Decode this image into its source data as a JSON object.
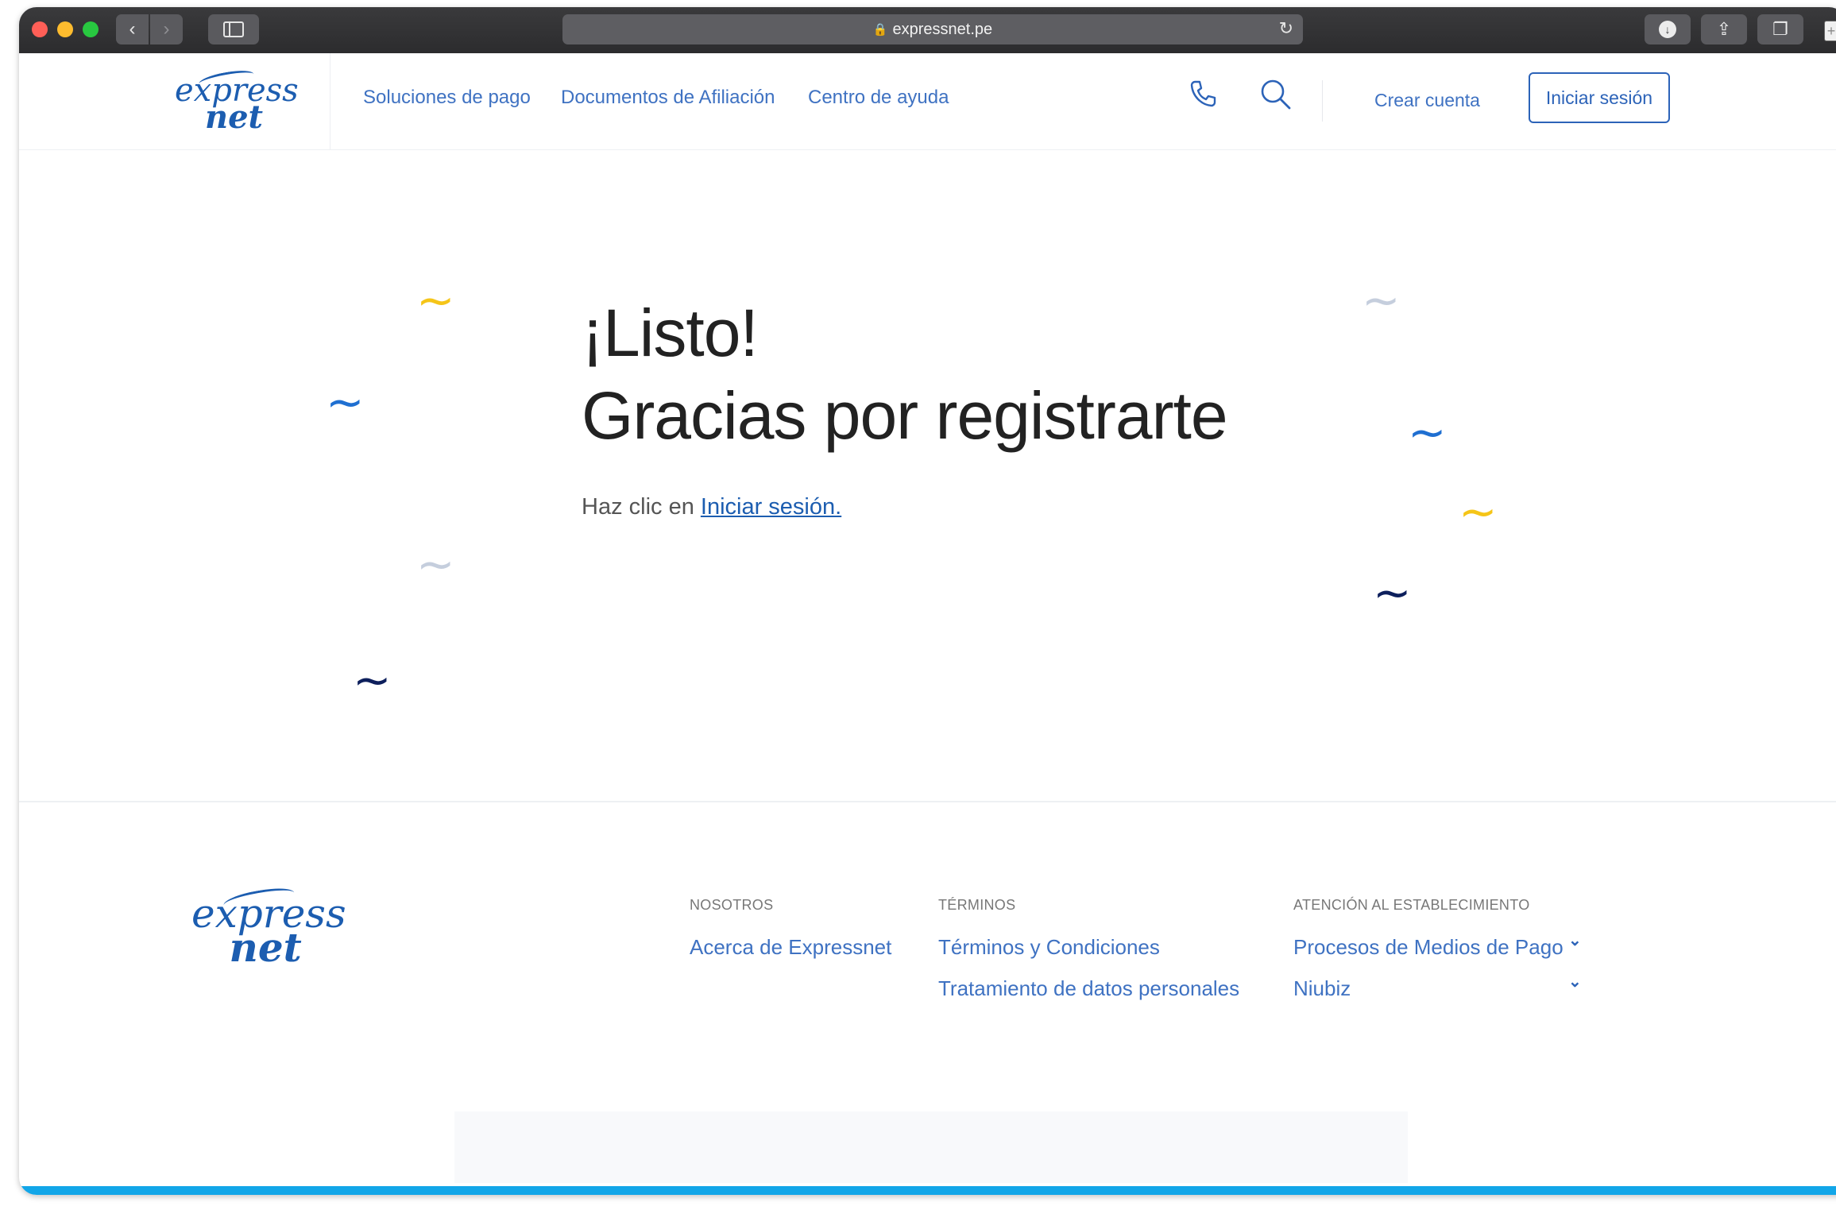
{
  "browser": {
    "url": "expressnet.pe",
    "back_glyph": "‹",
    "forward_glyph": "›",
    "reload_glyph": "↻",
    "lock_glyph": "🔒",
    "download_glyph": "↓",
    "share_glyph": "⇪",
    "tabs_glyph": "❐",
    "new_tab_glyph": "+"
  },
  "header": {
    "logo_line1": "express",
    "logo_line2": "net",
    "nav": [
      {
        "label": "Soluciones de pago"
      },
      {
        "label": "Documentos de Afiliación"
      },
      {
        "label": "Centro de ayuda"
      }
    ],
    "create_account": "Crear cuenta",
    "login": "Iniciar sesión"
  },
  "hero": {
    "title_line1": "¡Listo!",
    "title_line2": "Gracias por registrarte",
    "subtitle_prefix": "Haz clic en ",
    "subtitle_link": "Iniciar sesión."
  },
  "decor": {
    "tilde_glyph": "~",
    "colors": {
      "yellow": "#f5c518",
      "blue": "#1f6fd1",
      "navy": "#0d1f5c",
      "grey": "#c5cedd"
    }
  },
  "footer": {
    "logo_line1": "express",
    "logo_line2": "net",
    "columns": [
      {
        "heading": "NOSOTROS",
        "links": [
          "Acerca de Expressnet"
        ]
      },
      {
        "heading": "TÉRMINOS",
        "links": [
          "Términos y Condiciones",
          "Tratamiento de datos personales"
        ]
      },
      {
        "heading": "ATENCIÓN AL ESTABLECIMIENTO",
        "links": [
          "Procesos de Medios de Pago",
          "Niubiz"
        ]
      }
    ],
    "chevron_glyph": "⌄"
  },
  "colors": {
    "brand_blue": "#1c5db0",
    "link_blue": "#3f72c2",
    "bottom_stripe": "#12a6e8"
  }
}
